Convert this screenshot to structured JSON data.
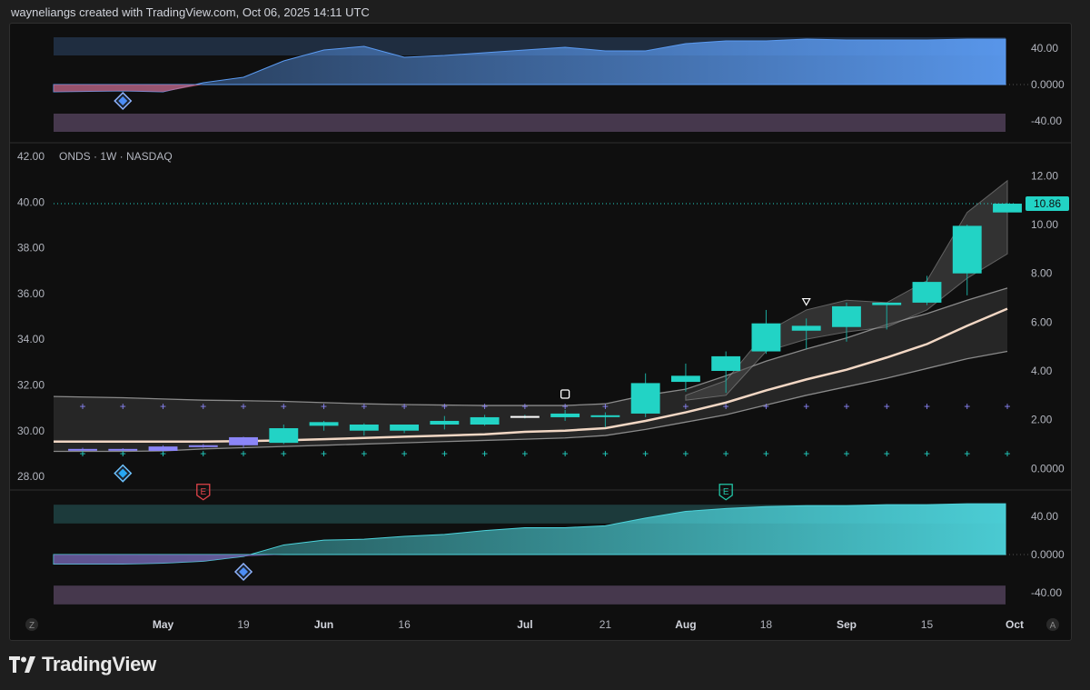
{
  "header": {
    "text": "wayneliangs created with TradingView.com, Oct 06, 2025 14:11 UTC"
  },
  "brand": {
    "name": "TradingView"
  },
  "colors": {
    "bull": "#22d3c5",
    "bear": "#8b85f7",
    "ema": "#f2d7c4",
    "oscUpper": "#5b9bf2",
    "oscLower": "#4dd4dc"
  },
  "chart_data": {
    "type": "candlestick",
    "symbol_label": "ONDS · 1W · NASDAQ",
    "last_price_label": "10.86",
    "x_labels": [
      {
        "text": "May",
        "i": 2,
        "bold": true
      },
      {
        "text": "19",
        "i": 4,
        "bold": false
      },
      {
        "text": "Jun",
        "i": 6,
        "bold": true
      },
      {
        "text": "16",
        "i": 8,
        "bold": false
      },
      {
        "text": "Jul",
        "i": 11,
        "bold": true
      },
      {
        "text": "21",
        "i": 13,
        "bold": false
      },
      {
        "text": "Aug",
        "i": 15,
        "bold": true
      },
      {
        "text": "18",
        "i": 17,
        "bold": false
      },
      {
        "text": "Sep",
        "i": 19,
        "bold": true
      },
      {
        "text": "15",
        "i": 21,
        "bold": false
      },
      {
        "text": "Oct",
        "i": 23,
        "bold": true
      }
    ],
    "left_axis": [
      "42.00",
      "40.00",
      "38.00",
      "36.00",
      "34.00",
      "32.00",
      "30.00",
      "28.00"
    ],
    "right_axis": [
      "12.00",
      "10.00",
      "8.00",
      "6.00",
      "4.00",
      "2.00",
      "0.0000"
    ],
    "price_range": [
      -0.4,
      12.8
    ],
    "candles": [
      {
        "o": 0.8,
        "h": 0.85,
        "l": 0.75,
        "c": 0.78
      },
      {
        "o": 0.8,
        "h": 0.83,
        "l": 0.76,
        "c": 0.78
      },
      {
        "o": 0.9,
        "h": 0.95,
        "l": 0.7,
        "c": 0.72
      },
      {
        "o": 0.95,
        "h": 1.0,
        "l": 0.85,
        "c": 0.9
      },
      {
        "o": 1.28,
        "h": 1.3,
        "l": 0.85,
        "c": 0.95
      },
      {
        "o": 1.05,
        "h": 1.8,
        "l": 1.0,
        "c": 1.65
      },
      {
        "o": 1.75,
        "h": 1.95,
        "l": 1.55,
        "c": 1.9
      },
      {
        "o": 1.55,
        "h": 1.85,
        "l": 1.35,
        "c": 1.8
      },
      {
        "o": 1.55,
        "h": 1.8,
        "l": 1.45,
        "c": 1.8
      },
      {
        "o": 1.8,
        "h": 2.15,
        "l": 1.6,
        "c": 1.95
      },
      {
        "o": 1.8,
        "h": 2.2,
        "l": 1.75,
        "c": 2.1
      },
      {
        "o": 2.15,
        "h": 2.2,
        "l": 2.05,
        "c": 2.12
      },
      {
        "o": 2.1,
        "h": 2.4,
        "l": 1.95,
        "c": 2.25
      },
      {
        "o": 2.15,
        "h": 2.3,
        "l": 1.7,
        "c": 2.18
      },
      {
        "o": 2.25,
        "h": 3.9,
        "l": 2.1,
        "c": 3.5
      },
      {
        "o": 3.55,
        "h": 4.3,
        "l": 3.15,
        "c": 3.8
      },
      {
        "o": 4.0,
        "h": 4.8,
        "l": 3.1,
        "c": 4.6
      },
      {
        "o": 4.8,
        "h": 6.5,
        "l": 4.7,
        "c": 5.95
      },
      {
        "o": 5.65,
        "h": 6.15,
        "l": 4.9,
        "c": 5.85
      },
      {
        "o": 5.8,
        "h": 6.8,
        "l": 5.2,
        "c": 6.65
      },
      {
        "o": 6.7,
        "h": 6.8,
        "l": 5.7,
        "c": 6.8
      },
      {
        "o": 6.8,
        "h": 7.9,
        "l": 6.7,
        "c": 7.65
      },
      {
        "o": 8.0,
        "h": 10.0,
        "l": 7.1,
        "c": 9.95
      },
      {
        "o": 10.5,
        "h": 10.9,
        "l": 10.5,
        "c": 10.86
      }
    ],
    "ema": [
      1.1,
      1.1,
      1.1,
      1.1,
      1.12,
      1.15,
      1.2,
      1.25,
      1.3,
      1.35,
      1.4,
      1.5,
      1.55,
      1.65,
      1.95,
      2.3,
      2.7,
      3.2,
      3.65,
      4.05,
      4.55,
      5.1,
      5.85,
      6.55
    ],
    "band_lower": [
      0.7,
      0.7,
      0.72,
      0.8,
      0.85,
      0.9,
      0.95,
      1.0,
      1.05,
      1.1,
      1.15,
      1.2,
      1.25,
      1.35,
      1.6,
      1.9,
      2.2,
      2.6,
      3.0,
      3.35,
      3.7,
      4.1,
      4.5,
      4.8
    ],
    "band_upper": [
      2.95,
      2.9,
      2.85,
      2.8,
      2.78,
      2.75,
      2.7,
      2.65,
      2.62,
      2.6,
      2.58,
      2.58,
      2.58,
      2.65,
      3.0,
      3.25,
      3.8,
      4.4,
      4.9,
      5.35,
      5.9,
      6.35,
      6.9,
      7.4
    ],
    "cloud_upper": [
      null,
      null,
      null,
      null,
      null,
      null,
      null,
      null,
      null,
      null,
      null,
      null,
      null,
      null,
      null,
      3.0,
      3.6,
      5.6,
      6.5,
      6.9,
      6.8,
      7.7,
      10.5,
      11.8
    ],
    "cloud_lower": [
      null,
      null,
      null,
      null,
      null,
      null,
      null,
      null,
      null,
      null,
      null,
      null,
      null,
      null,
      null,
      2.8,
      3.0,
      4.8,
      5.3,
      5.6,
      5.8,
      6.5,
      7.8,
      8.8
    ],
    "upper_markers_value": 2.55,
    "lower_markers_value": 0.6,
    "signals": [
      {
        "type": "diamond",
        "i": 1,
        "pane": "price"
      },
      {
        "type": "earnings",
        "i": 3,
        "pane": "price",
        "color": "#e0434a"
      },
      {
        "type": "earnings",
        "i": 16,
        "pane": "price",
        "color": "#22c6a7"
      },
      {
        "type": "square",
        "i": 12,
        "pane": "price"
      },
      {
        "type": "triangle",
        "i": 18,
        "pane": "price"
      }
    ],
    "osc_top": {
      "axis": [
        "40.00",
        "0.0000",
        "-40.00"
      ],
      "range": [
        -55,
        55
      ],
      "values": [
        -8,
        -7,
        -8,
        2,
        8,
        26,
        38,
        42,
        30,
        32,
        35,
        38,
        41,
        37,
        37,
        45,
        48,
        48,
        50,
        49,
        49,
        49,
        50,
        50
      ],
      "diamond_i": 1
    },
    "osc_bottom": {
      "axis": [
        "40.00",
        "0.0000",
        "-40.00"
      ],
      "range": [
        -55,
        55
      ],
      "values": [
        -10,
        -10,
        -9,
        -7,
        -2,
        10,
        15,
        16,
        19,
        21,
        25,
        28,
        28,
        30,
        38,
        45,
        48,
        50,
        51,
        51,
        52,
        52,
        53,
        53
      ],
      "diamond_i": 4
    }
  }
}
